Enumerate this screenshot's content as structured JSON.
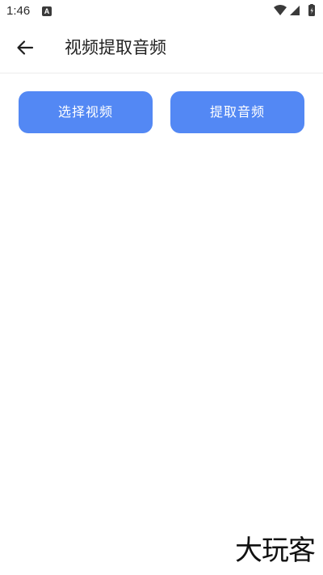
{
  "status_bar": {
    "time": "1:46",
    "notification_icon_letter": "A",
    "icons": [
      "wifi-icon",
      "signal-icon",
      "battery-charging-icon"
    ]
  },
  "app_bar": {
    "back_icon": "arrow-left-icon",
    "title": "视频提取音频"
  },
  "actions": {
    "select_video_label": "选择视频",
    "extract_audio_label": "提取音频"
  },
  "watermark": {
    "text": "大玩客"
  },
  "colors": {
    "accent": "#5388f4",
    "background": "#ffffff",
    "text": "#222222"
  }
}
